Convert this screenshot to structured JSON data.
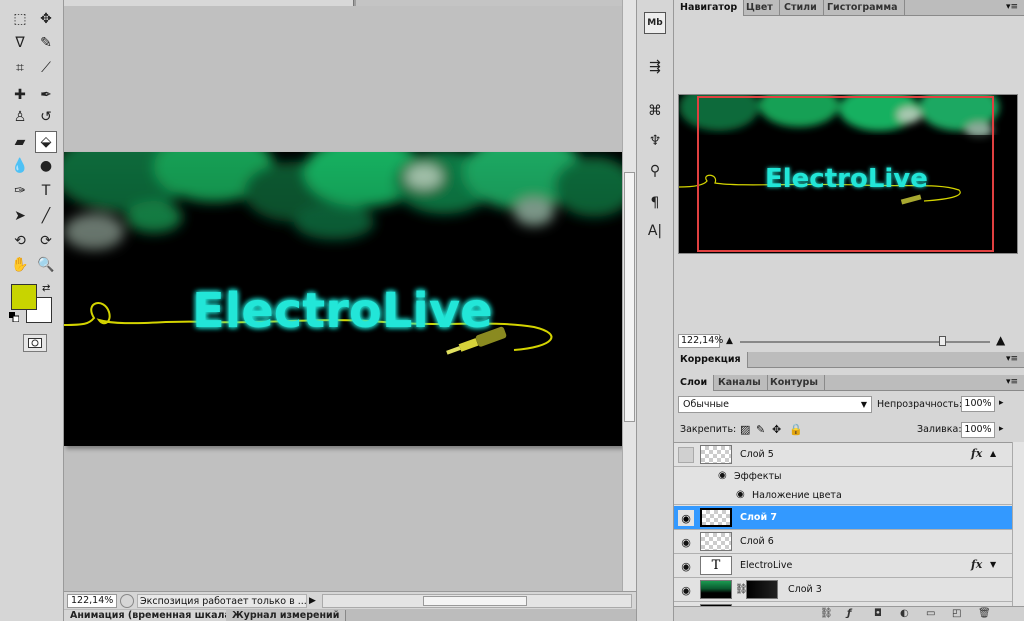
{
  "colors": {
    "foreground": "#c8d400",
    "background": "#ffffff",
    "selection": "#3399ff",
    "navigator_frame": "#e04040"
  },
  "tools": [
    {
      "name": "marquee-icon",
      "glyph": "⬚"
    },
    {
      "name": "move-icon",
      "glyph": "✥"
    },
    {
      "name": "lasso-icon",
      "glyph": "ᐁ"
    },
    {
      "name": "quick-selection-icon",
      "glyph": "✎"
    },
    {
      "name": "crop-icon",
      "glyph": "⌗"
    },
    {
      "name": "eyedropper-icon",
      "glyph": "⟋"
    },
    {
      "name": "healing-brush-icon",
      "glyph": "✚"
    },
    {
      "name": "brush-icon",
      "glyph": "✒"
    },
    {
      "name": "clone-stamp-icon",
      "glyph": "♙"
    },
    {
      "name": "history-brush-icon",
      "glyph": "↺"
    },
    {
      "name": "eraser-icon",
      "glyph": "▰"
    },
    {
      "name": "paint-bucket-icon",
      "glyph": "⬙"
    },
    {
      "name": "blur-icon",
      "glyph": "💧"
    },
    {
      "name": "dodge-icon",
      "glyph": "●"
    },
    {
      "name": "pen-icon",
      "glyph": "✑"
    },
    {
      "name": "type-icon",
      "glyph": "T"
    },
    {
      "name": "path-selection-icon",
      "glyph": "➤"
    },
    {
      "name": "line-icon",
      "glyph": "╱"
    },
    {
      "name": "3d-rotate-icon",
      "glyph": "⟲"
    },
    {
      "name": "3d-orbit-icon",
      "glyph": "⟳"
    },
    {
      "name": "hand-icon",
      "glyph": "✋"
    },
    {
      "name": "zoom-icon",
      "glyph": "🔍"
    }
  ],
  "swap_glyph": "⇄",
  "status": {
    "zoom": "122,14%",
    "text": "Экспозиция работает только в ...",
    "arrow": "▶"
  },
  "bottom_tabs": [
    "Анимация (временная шкала)",
    "Журнал измерений"
  ],
  "strip_icons": [
    {
      "name": "mini-bridge-icon",
      "glyph": "Mb"
    },
    {
      "name": "history-icon",
      "glyph": "⇶"
    },
    {
      "name": "brush-presets-icon",
      "glyph": "⌘"
    },
    {
      "name": "clone-source-icon",
      "glyph": "♆"
    },
    {
      "name": "tool-presets-icon",
      "glyph": "⚲"
    },
    {
      "name": "paragraph-icon",
      "glyph": "¶"
    },
    {
      "name": "character-icon",
      "glyph": "A|"
    }
  ],
  "navigator_panel": {
    "tabs": [
      "Навигатор",
      "Цвет",
      "Стили",
      "Гистограмма"
    ],
    "zoom": "122,14%"
  },
  "correction_panel": {
    "tabs": [
      "Коррекция"
    ]
  },
  "layers_panel": {
    "tabs": [
      "Слои",
      "Каналы",
      "Контуры"
    ],
    "blend_mode": "Обычные",
    "opacity_label": "Непрозрачность:",
    "opacity": "100%",
    "lock_label": "Закрепить:",
    "fill_label": "Заливка:",
    "fill": "100%",
    "layers": [
      {
        "name": "Слой 5",
        "fx": "fx",
        "visible": false
      },
      {
        "name": "Слой 7",
        "selected": true,
        "visible": true
      },
      {
        "name": "Слой 6",
        "visible": true
      },
      {
        "name": "ElectroLive",
        "fx": "fx",
        "visible": true,
        "thumb_text": "T"
      },
      {
        "name": "Слой 3",
        "visible": true
      }
    ],
    "effects_label": "Эффекты",
    "color_overlay_label": "Наложение цвета"
  },
  "artwork": {
    "title": "ElectroLive",
    "glow_color": "#22e6d8",
    "cable_color": "#d4d400"
  },
  "menu_glyph": "▾≡"
}
